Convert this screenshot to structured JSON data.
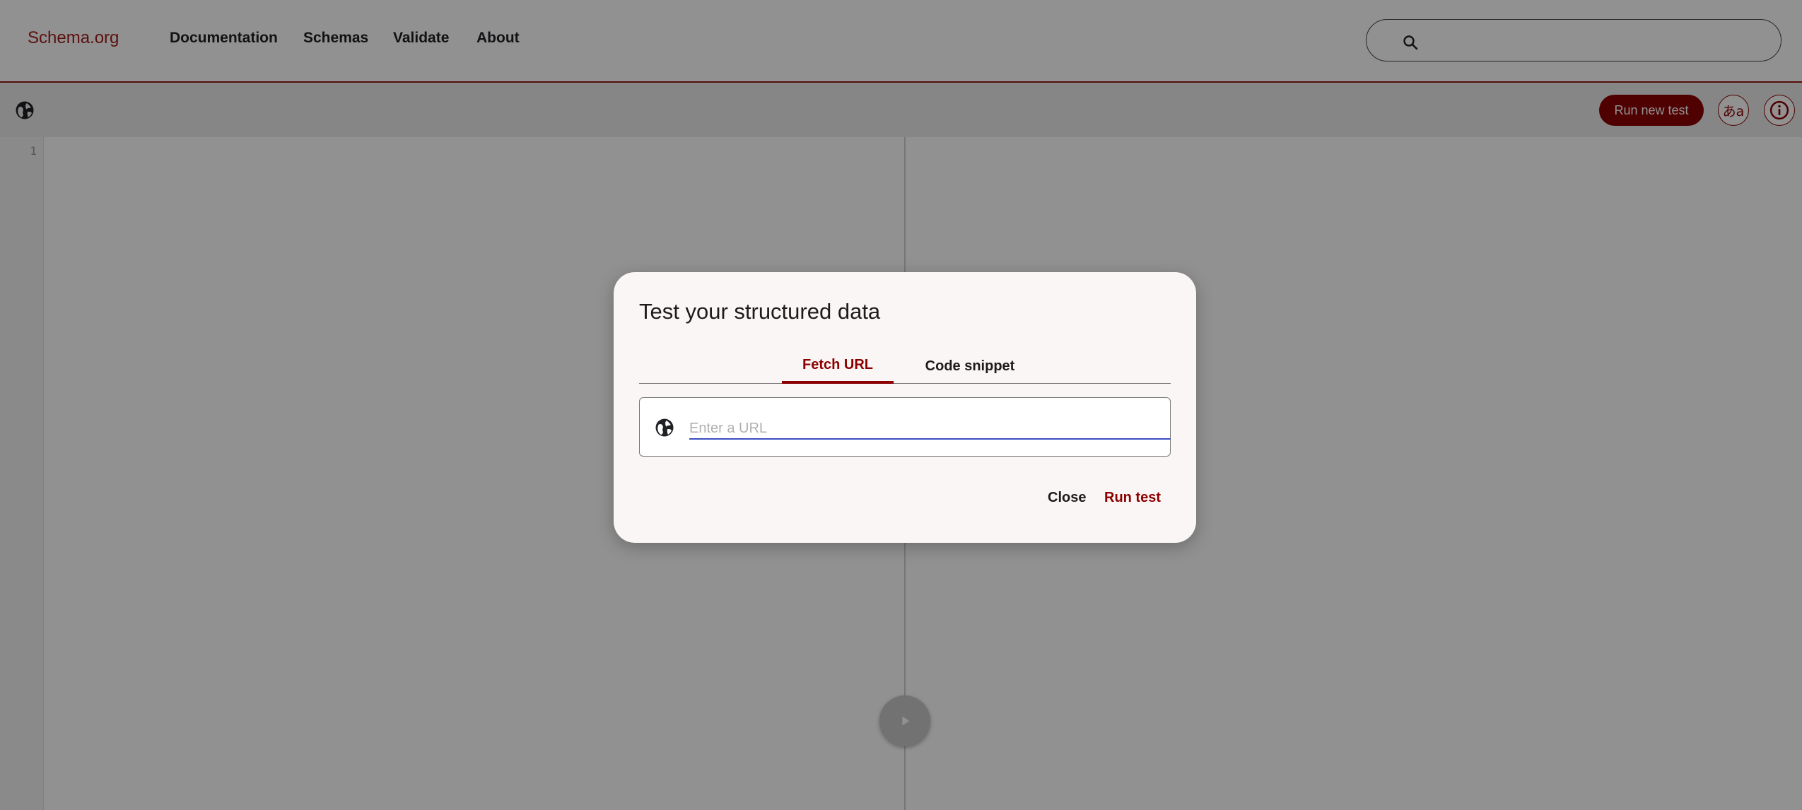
{
  "header": {
    "logo": "Schema.org",
    "nav": [
      "Documentation",
      "Schemas",
      "Validate",
      "About"
    ],
    "search_placeholder": ""
  },
  "toolbar": {
    "run_new_test": "Run new test",
    "language_glyph": "あa",
    "info_glyph": "i"
  },
  "editor": {
    "line_numbers": [
      "1"
    ]
  },
  "dialog": {
    "title": "Test your structured data",
    "tabs": {
      "active": "Fetch URL",
      "inactive": "Code snippet"
    },
    "url_placeholder": "Enter a URL",
    "close_label": "Close",
    "run_label": "Run test"
  },
  "colors": {
    "brand": "#8b0000",
    "input_underline": "#3b4cc0"
  },
  "icons": [
    "search-icon",
    "globe-icon",
    "language-icon",
    "info-icon",
    "play-icon"
  ]
}
